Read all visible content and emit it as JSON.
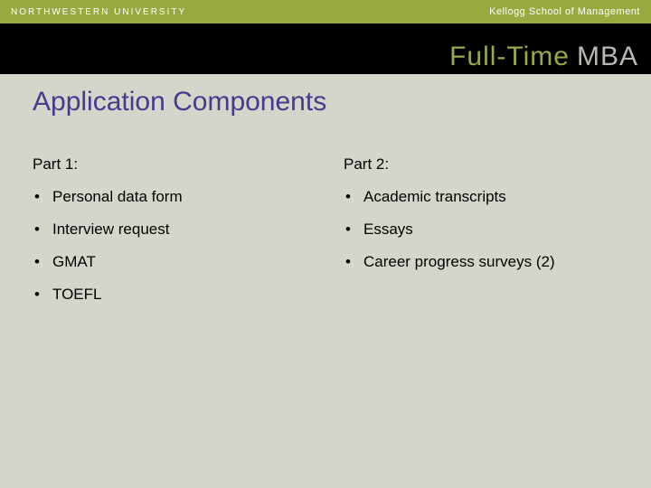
{
  "header": {
    "university": "NORTHWESTERN UNIVERSITY",
    "school": "Kellogg School of Management"
  },
  "program": {
    "prefix": "Full-Time",
    "suffix": "MBA"
  },
  "slide": {
    "title": "Application Components"
  },
  "columns": [
    {
      "heading": "Part 1:",
      "items": [
        "Personal data form",
        "Interview request",
        "GMAT",
        "TOEFL"
      ]
    },
    {
      "heading": "Part 2:",
      "items": [
        "Academic transcripts",
        "Essays",
        "Career progress surveys (2)"
      ]
    }
  ]
}
